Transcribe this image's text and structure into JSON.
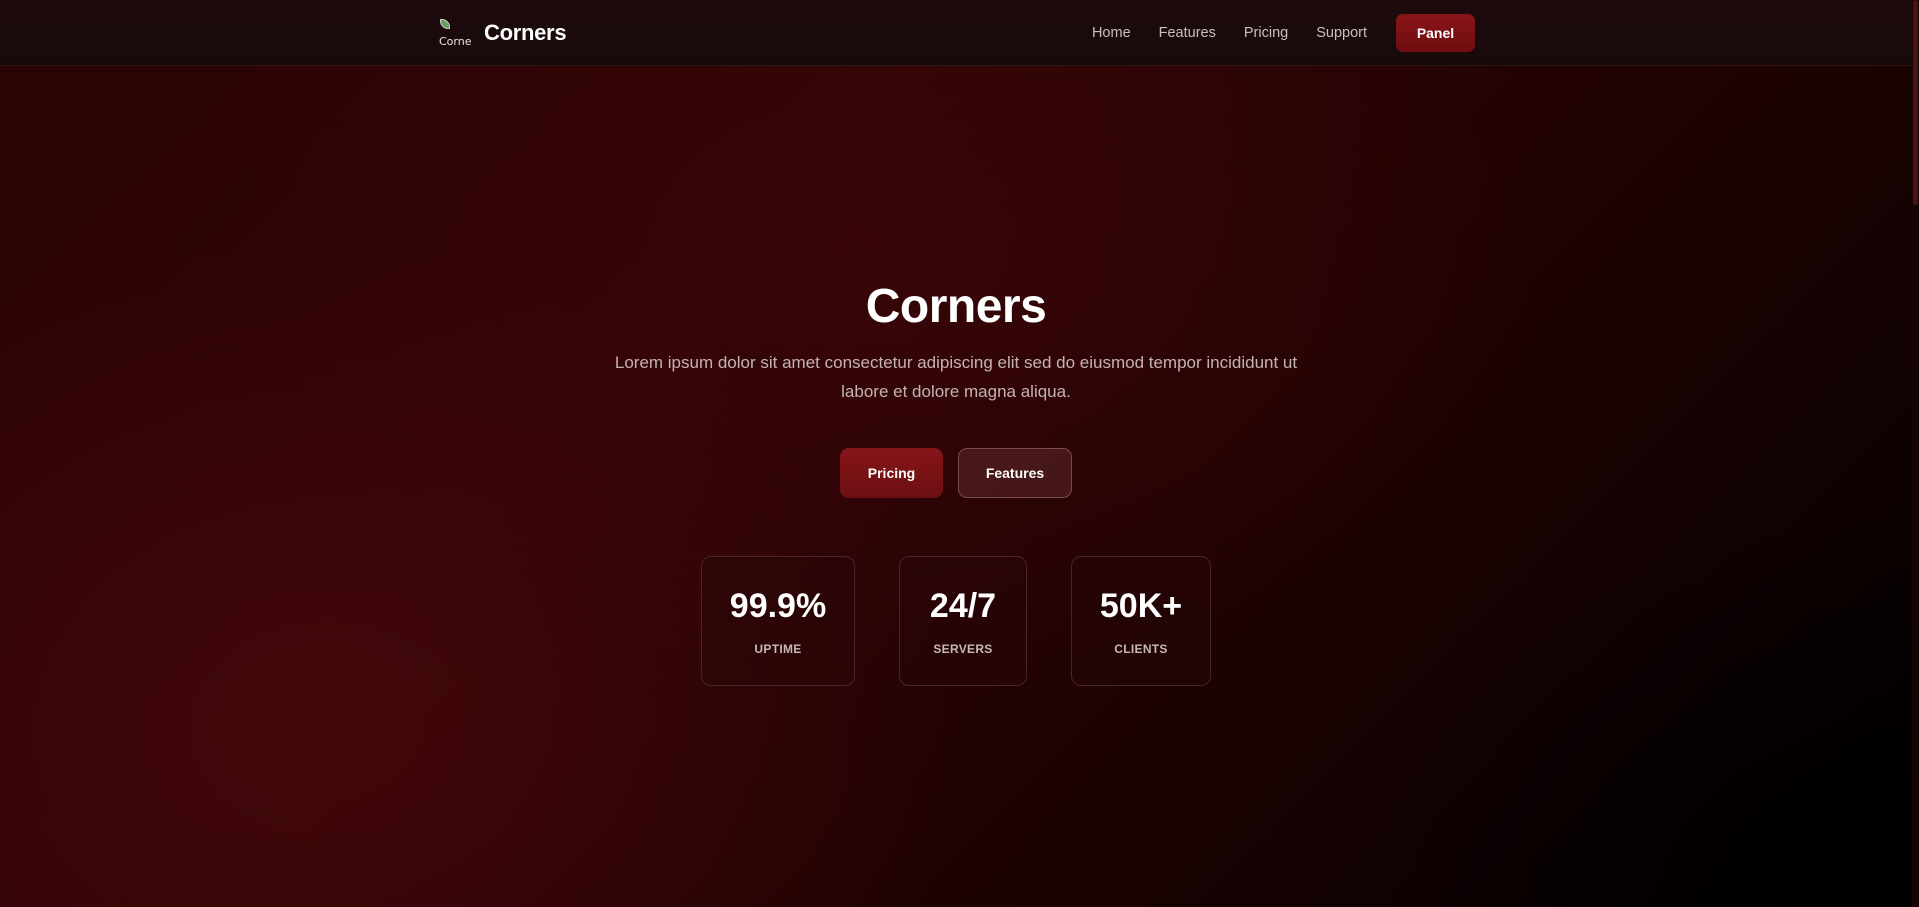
{
  "header": {
    "brand_name": "Corners",
    "logo_alt": "Corne",
    "nav": [
      "Home",
      "Features",
      "Pricing",
      "Support"
    ],
    "panel_label": "Panel"
  },
  "hero": {
    "title": "Corners",
    "description": "Lorem ipsum dolor sit amet consectetur adipiscing elit sed do eiusmod tempor incididunt ut labore et dolore magna aliqua.",
    "primary_cta": "Pricing",
    "secondary_cta": "Features"
  },
  "stats": [
    {
      "value": "99.9%",
      "label": "UPTIME"
    },
    {
      "value": "24/7",
      "label": "SERVERS"
    },
    {
      "value": "50K+",
      "label": "CLIENTS"
    }
  ],
  "colors": {
    "accent": "#7a1115",
    "background_dark": "#2b0305",
    "navbar_bg": "#1a0a0b"
  }
}
